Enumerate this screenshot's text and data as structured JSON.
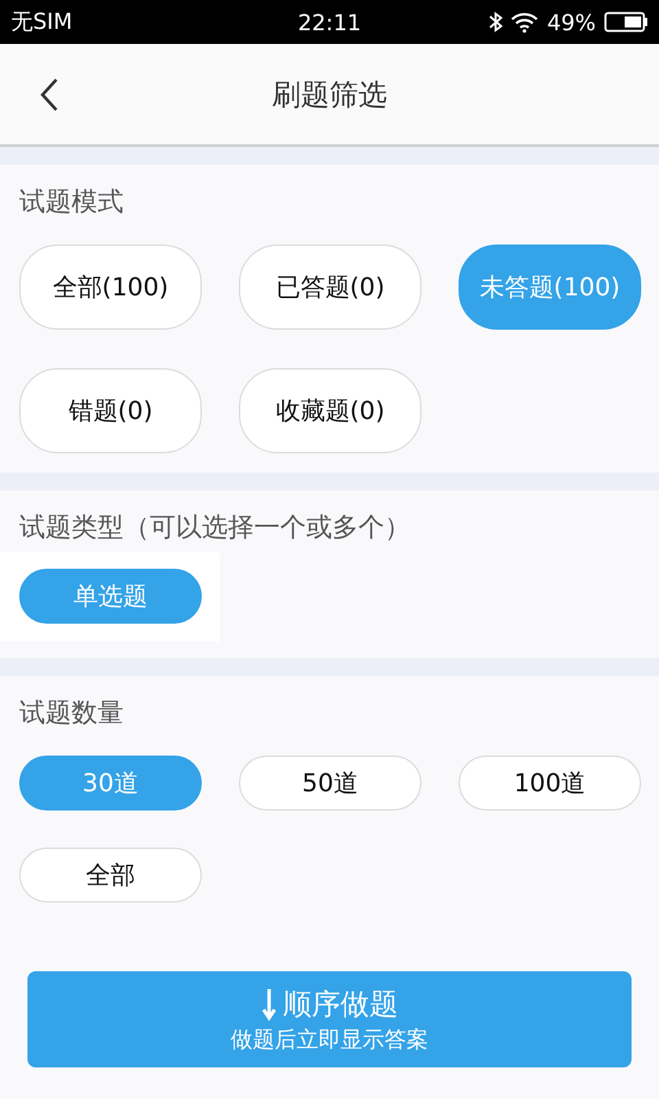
{
  "status_bar": {
    "carrier": "无SIM",
    "time": "22:11",
    "battery": "49%"
  },
  "header": {
    "title": "刷题筛选"
  },
  "sections": [
    {
      "title": "试题模式",
      "kind": "tall",
      "highlight": false,
      "options": [
        {
          "label": "全部(100)",
          "selected": false
        },
        {
          "label": "已答题(0)",
          "selected": false
        },
        {
          "label": "未答题(100)",
          "selected": true
        },
        {
          "label": "错题(0)",
          "selected": false
        },
        {
          "label": "收藏题(0)",
          "selected": false
        }
      ]
    },
    {
      "title": "试题类型（可以选择一个或多个）",
      "kind": "short",
      "highlight": true,
      "options": [
        {
          "label": "单选题",
          "selected": true
        }
      ]
    },
    {
      "title": "试题数量",
      "kind": "short",
      "highlight": false,
      "options": [
        {
          "label": "30道",
          "selected": true
        },
        {
          "label": "50道",
          "selected": false
        },
        {
          "label": "100道",
          "selected": false
        },
        {
          "label": "全部",
          "selected": false
        }
      ]
    }
  ],
  "start_button": {
    "label": "顺序做题",
    "sublabel": "做题后立即显示答案"
  }
}
